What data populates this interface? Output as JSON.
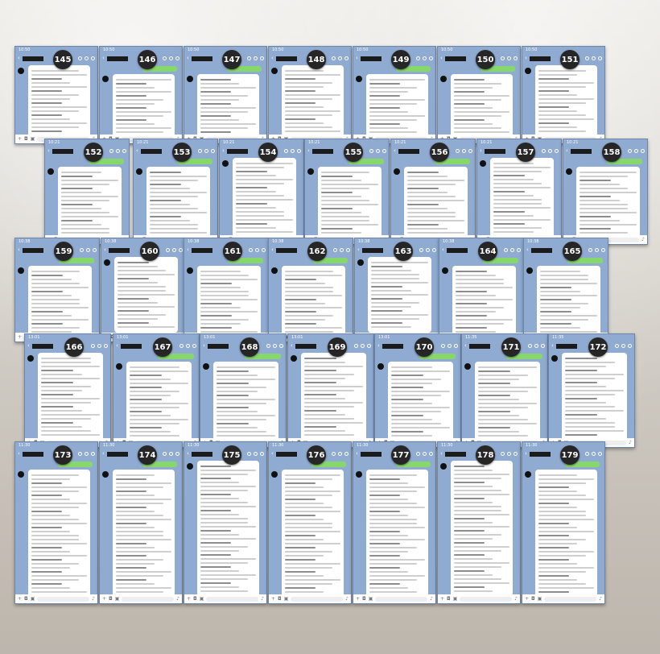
{
  "screenshots": [
    {
      "number": "145",
      "time": "10:50"
    },
    {
      "number": "146",
      "time": "10:50"
    },
    {
      "number": "147",
      "time": "10:50"
    },
    {
      "number": "148",
      "time": "10:50"
    },
    {
      "number": "149",
      "time": "10:50"
    },
    {
      "number": "150",
      "time": "10:50"
    },
    {
      "number": "151",
      "time": "10:50"
    },
    {
      "number": "152",
      "time": "10:21"
    },
    {
      "number": "153",
      "time": "10:21"
    },
    {
      "number": "154",
      "time": "10:21"
    },
    {
      "number": "155",
      "time": "10:21"
    },
    {
      "number": "156",
      "time": "10:21"
    },
    {
      "number": "157",
      "time": "10:21"
    },
    {
      "number": "158",
      "time": "10:21"
    },
    {
      "number": "159",
      "time": "10:38"
    },
    {
      "number": "160",
      "time": "10:38"
    },
    {
      "number": "161",
      "time": "10:38"
    },
    {
      "number": "162",
      "time": "10:38"
    },
    {
      "number": "163",
      "time": "10:38"
    },
    {
      "number": "164",
      "time": "10:38"
    },
    {
      "number": "165",
      "time": "10:38"
    },
    {
      "number": "166",
      "time": "13:01"
    },
    {
      "number": "167",
      "time": "13:01"
    },
    {
      "number": "168",
      "time": "13:01"
    },
    {
      "number": "169",
      "time": "13:01"
    },
    {
      "number": "170",
      "time": "13:01"
    },
    {
      "number": "171",
      "time": "11:35"
    },
    {
      "number": "172",
      "time": "11:35"
    },
    {
      "number": "173",
      "time": "11:30"
    },
    {
      "number": "174",
      "time": "11:30"
    },
    {
      "number": "175",
      "time": "11:30"
    },
    {
      "number": "176",
      "time": "11:30"
    },
    {
      "number": "177",
      "time": "11:30"
    },
    {
      "number": "178",
      "time": "11:30"
    },
    {
      "number": "179",
      "time": "11:30"
    }
  ],
  "colors": {
    "chat_background": "#8fabd1",
    "sent_bubble": "#87d86a",
    "received_bubble": "#ffffff",
    "badge": "#262626"
  },
  "icons": [
    "back-chevron-icon",
    "search-icon",
    "phone-icon",
    "menu-icon",
    "plus-icon",
    "camera-icon",
    "image-icon",
    "mic-icon"
  ]
}
